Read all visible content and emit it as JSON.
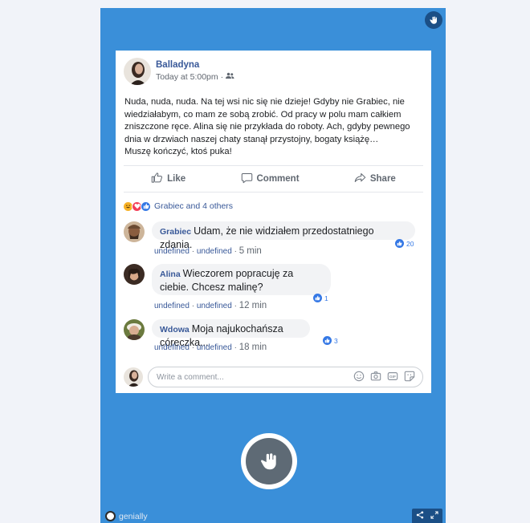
{
  "post": {
    "author": "Balladyna",
    "timestamp": "Today at 5:00pm",
    "separator": "·",
    "body": "Nuda, nuda, nuda. Na tej wsi nic się nie dzieje! Gdyby nie Grabiec, nie\nwiedziałabym, co mam ze sobą zrobić. Od pracy w polu mam całkiem\nzniszczone ręce. Alina się nie przykłada do roboty. Ach, gdyby pewnego\ndnia w drzwiach naszej chaty stanął przystojny, bogaty książę…\nMuszę kończyć, ktoś puka!"
  },
  "actions": {
    "like": "Like",
    "comment": "Comment",
    "share": "Share"
  },
  "reactions": {
    "summary": "Grabiec and 4 others",
    "types": [
      "haha",
      "love",
      "like"
    ]
  },
  "comments": [
    {
      "name": "Grabiec",
      "text": "Udam, że nie widziałem przedostatniego zdania.",
      "likes": "20",
      "action1": "undefined",
      "action2": "undefined",
      "dot": "·",
      "time": "5 min"
    },
    {
      "name": "Alina",
      "text": "Wieczorem popracuję za ciebie. Chcesz malinę?",
      "likes": "1",
      "action1": "undefined",
      "action2": "undefined",
      "dot": "·",
      "time": "12 min"
    },
    {
      "name": "Wdowa",
      "text": "Moja najukochańsza córeczka...",
      "likes": "3",
      "action1": "undefined",
      "action2": "undefined",
      "dot": "·",
      "time": "18 min"
    }
  ],
  "composer": {
    "placeholder": "Write a comment...",
    "tools": [
      "emoji-icon",
      "camera-icon",
      "gif-icon",
      "sticker-icon"
    ]
  },
  "footer": {
    "brand": "genially"
  },
  "colors": {
    "stage": "#3a8fd9",
    "link": "#385898",
    "like": "#3578e5"
  }
}
